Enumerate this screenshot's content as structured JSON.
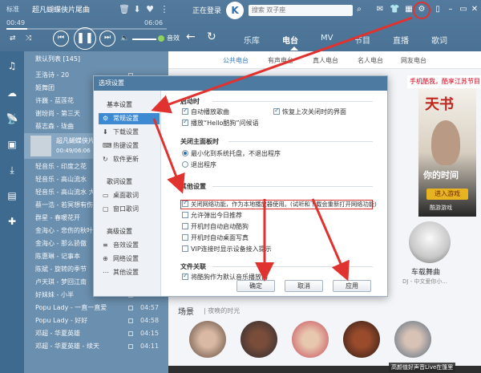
{
  "player": {
    "mode_label": "标准",
    "song_title": "超凡蝴蝶俠片尾曲",
    "elapsed": "00:49",
    "total": "06:06",
    "progress": 0.13,
    "login_text": "正在登录",
    "logo_letter": "K",
    "search_placeholder": "搜索 双子座",
    "pure_label": "音效",
    "nav_tabs": [
      "乐库",
      "电台",
      "MV",
      "节目",
      "直播",
      "歌词"
    ],
    "active_tab": "电台"
  },
  "playlist": {
    "header": "默认列表 [145]",
    "items": [
      {
        "name": "王洛诗 - 20",
        "dur": ""
      },
      {
        "name": "姬舞团",
        "dur": ""
      },
      {
        "name": "许巍 - 蓝莲花",
        "dur": ""
      },
      {
        "name": "谢玢尚 - 第三天",
        "dur": ""
      },
      {
        "name": "蔡志森 - 珑曲",
        "dur": ""
      }
    ],
    "current": {
      "name": "超凡蝴蝶侠片",
      "time": "00:49/06:06"
    },
    "items2": [
      {
        "name": "轻音乐 - 印度之花",
        "dur": ""
      },
      {
        "name": "轻音乐 - 高山流水",
        "dur": ""
      },
      {
        "name": "轻音乐 - 高山流水 大自然",
        "dur": ""
      },
      {
        "name": "蔡一浩 - 若冥想有伤",
        "dur": ""
      },
      {
        "name": "群星 - 春暖花开",
        "dur": ""
      },
      {
        "name": "金海心 - 悲伤的秋叶",
        "dur": ""
      },
      {
        "name": "金海心 - 那么骄傲",
        "dur": ""
      },
      {
        "name": "陈惠琳 - 记事本",
        "dur": ""
      },
      {
        "name": "陈斌 - 旋转的季节",
        "dur": ""
      },
      {
        "name": "卢天琪 - 梦回江南",
        "dur": ""
      },
      {
        "name": "好妹妹 - 小半",
        "dur": ""
      },
      {
        "name": "Popu Lady - 一直一直爱",
        "dur": "04:57"
      },
      {
        "name": "Popu Lady - 好好",
        "dur": "04:58"
      },
      {
        "name": "邓超 - 华夏英雄",
        "dur": "04:15"
      },
      {
        "name": "邓超 - 华夏英雄 - 续天",
        "dur": "04:11"
      }
    ]
  },
  "content": {
    "subtabs": [
      "公共电台",
      "有声电台",
      "真人电台",
      "名人电台",
      "网友电台"
    ],
    "active_subtab": "公共电台",
    "banner": "手机酷我，酷享江苏节目",
    "ad": {
      "title": "天书",
      "subtitle": "你的时间",
      "button": "进入游戏",
      "tag": "酷游游戏"
    },
    "car": {
      "title": "车载舞曲",
      "sub": "DJ - 中文爱你小..."
    },
    "scene": {
      "title": "场景",
      "sub": "| 夜晚的时光"
    },
    "bottom_text": "高颜值好声音Live在篷里"
  },
  "dialog": {
    "title": "选项设置",
    "side": {
      "basic_head": "基本设置",
      "basic_items": [
        "常规设置",
        "下载设置",
        "热键设置",
        "软件更新"
      ],
      "lyric_head": "歌词设置",
      "lyric_items": [
        "桌面歌词",
        "窗口歌词"
      ],
      "adv_head": "高级设置",
      "adv_items": [
        "音效设置",
        "网络设置",
        "其他设置"
      ],
      "active": "常规设置"
    },
    "startup_head": "启动时",
    "startup": [
      {
        "label": "自动播放歌曲",
        "checked": true
      },
      {
        "label": "恢复上次关闭时的界面",
        "checked": true
      },
      {
        "label": "播放“Hello酷狗”问候语",
        "checked": true
      }
    ],
    "close_head": "关闭主面板时",
    "close": [
      {
        "label": "最小化到系统托盘，不退出程序",
        "on": true
      },
      {
        "label": "退出程序",
        "on": false
      }
    ],
    "other_head": "其他设置",
    "other": [
      {
        "label": "关闭网络功能，作为本地播放器使用。(试听和下载会重新打开网络功能)",
        "checked": true
      },
      {
        "label": "允许弹出今日推荐",
        "checked": false
      },
      {
        "label": "开机时自动启动酷狗",
        "checked": false
      },
      {
        "label": "开机时自动桌面写真",
        "checked": false
      },
      {
        "label": "VIP连接时显示设备接入提示",
        "checked": false
      }
    ],
    "file_head": "文件关联",
    "file": [
      {
        "label": "将酷狗作为默认音乐播放器",
        "checked": true
      }
    ],
    "buttons": {
      "ok": "确定",
      "cancel": "取消",
      "apply": "应用"
    }
  },
  "colors": {
    "accent": "#3d8ad3",
    "highlight": "#e0322f",
    "title_bar": "#4c7aa0"
  }
}
